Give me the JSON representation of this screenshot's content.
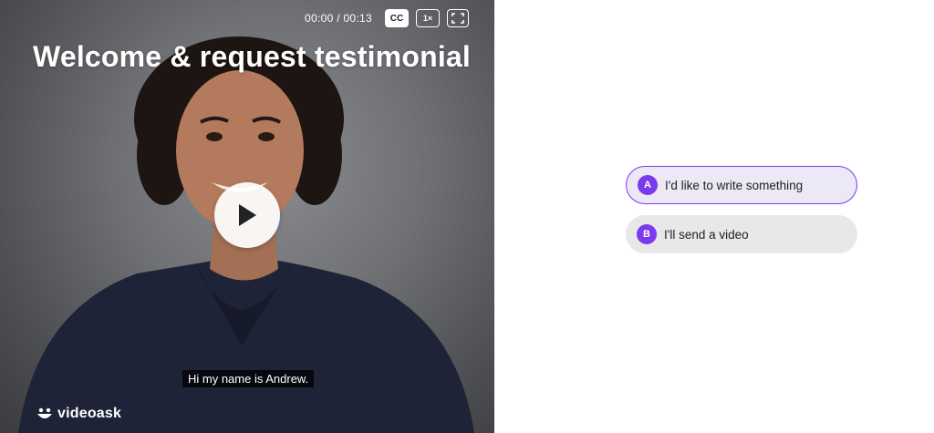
{
  "video": {
    "title": "Welcome & request testimonial",
    "time": "00:00 / 00:13",
    "cc_label": "CC",
    "speed_label": "1×",
    "caption": "Hi my name is Andrew.",
    "brand": "videoask"
  },
  "choices": [
    {
      "letter": "A",
      "label": "I'd like to write something"
    },
    {
      "letter": "B",
      "label": "I'll send a video"
    }
  ],
  "colors": {
    "accent": "#7c3aed",
    "choice_bg": "#e8e8e8"
  }
}
